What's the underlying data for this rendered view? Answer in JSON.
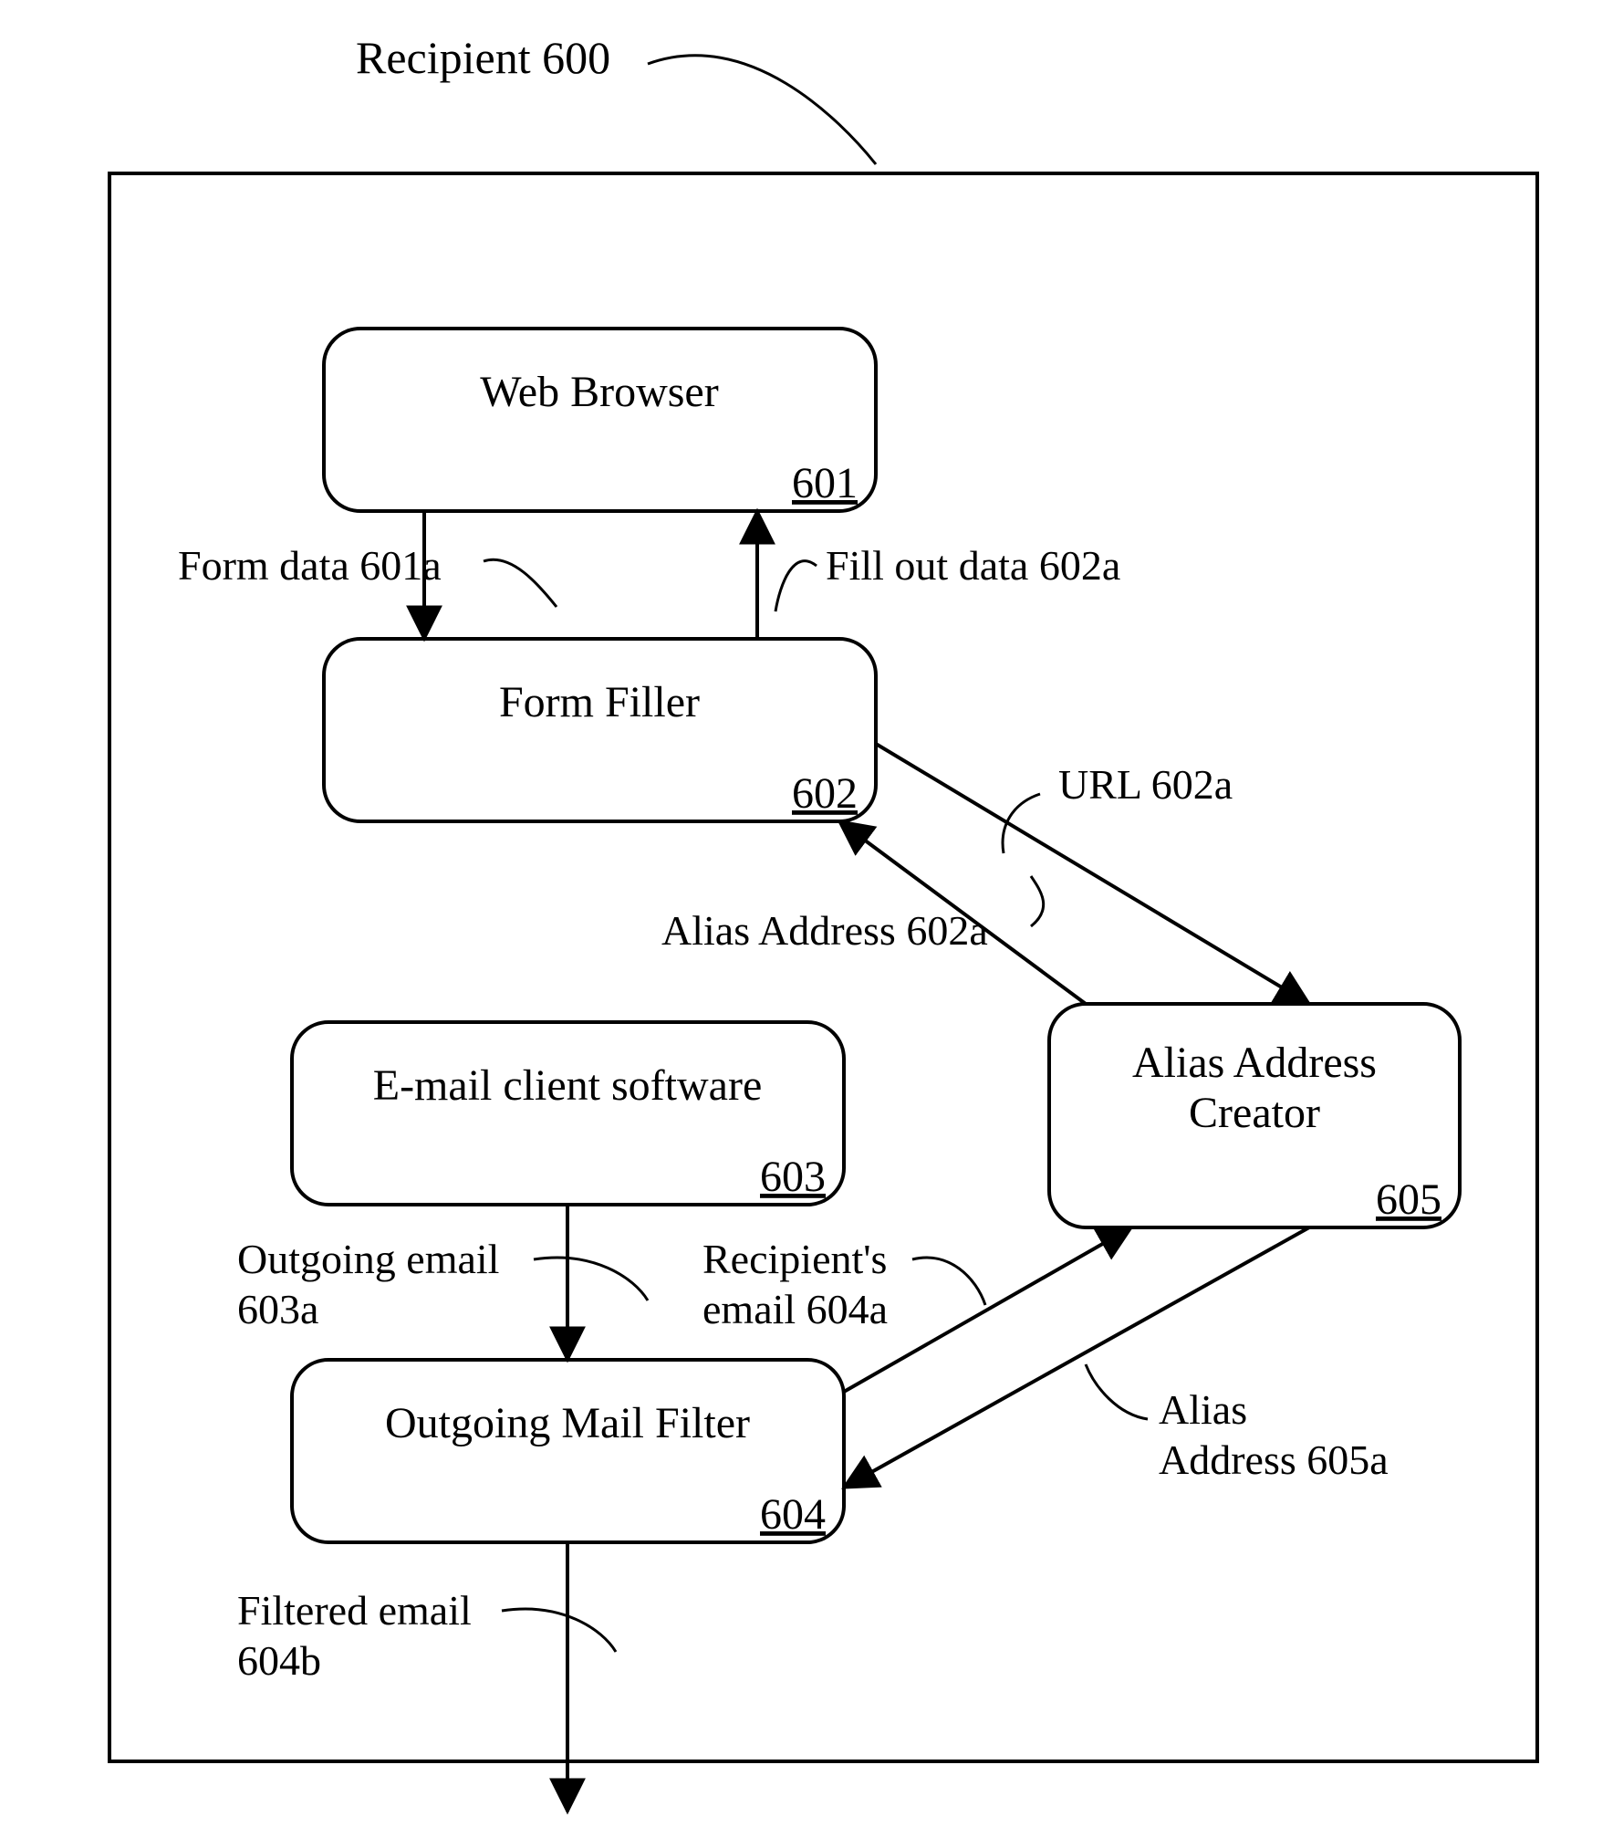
{
  "title": {
    "label": "Recipient",
    "num": "600"
  },
  "boxes": {
    "web_browser": {
      "label": "Web Browser",
      "num": "601"
    },
    "form_filler": {
      "label": "Form Filler",
      "num": "602"
    },
    "email_client": {
      "label": "E-mail client software",
      "num": "603"
    },
    "mail_filter": {
      "label": "Outgoing Mail Filter",
      "num": "604"
    },
    "alias_creator": {
      "label1": "Alias Address",
      "label2": "Creator",
      "num": "605"
    }
  },
  "edges": {
    "form_data": {
      "text": "Form data 601a"
    },
    "fill_out": {
      "text": "Fill out data 602a"
    },
    "url": {
      "text": "URL 602a"
    },
    "alias_addr_to_filler": {
      "text": "Alias Address 602a"
    },
    "outgoing_email": {
      "line1": "Outgoing email",
      "line2": "603a"
    },
    "recipient_email": {
      "line1": "Recipient's",
      "line2": "email 604a"
    },
    "alias_addr_to_filter": {
      "line1": "Alias",
      "line2": "Address 605a"
    },
    "filtered_email": {
      "line1": "Filtered email",
      "line2": "604b"
    }
  }
}
